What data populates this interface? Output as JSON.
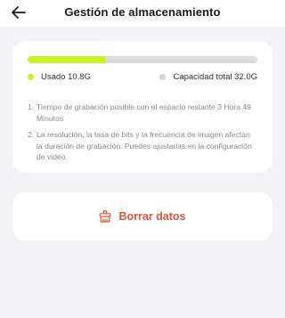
{
  "header": {
    "title": "Gestión de almacenamiento",
    "back_icon": "arrow-left-icon"
  },
  "storage": {
    "used_label": "Usado 10.8G",
    "total_label": "Capacidad total 32.0G",
    "used_fraction": 0.3375,
    "used_color": "#c8f22a",
    "total_color": "#d5d5d8"
  },
  "notes": [
    {
      "number": "1.",
      "text": "Tiempo de grabación posible con el espacio restante 3 Hora 49 Minutos"
    },
    {
      "number": "2.",
      "text": "La resolución, la tasa de bits y la frecuencia de imagen afectan la duración de grabación. Puedes ajustarlas en la configuración de video."
    }
  ],
  "clear": {
    "label": "Borrar datos",
    "icon": "broom-icon",
    "color": "#e0533c"
  }
}
